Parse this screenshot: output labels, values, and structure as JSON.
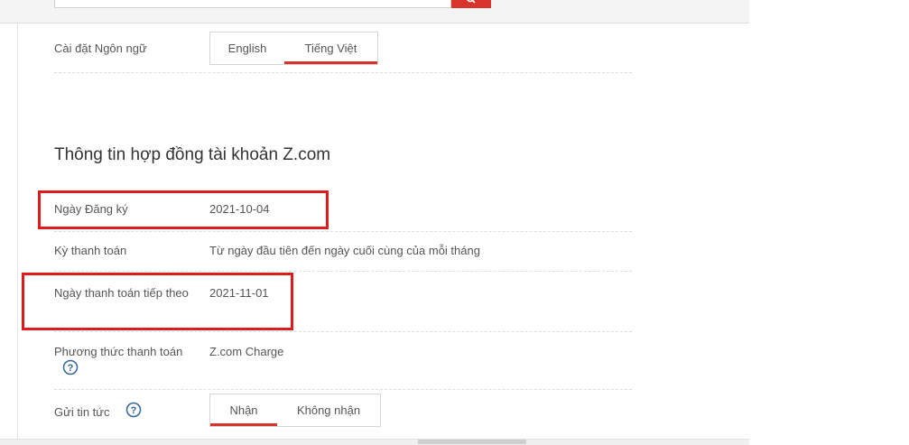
{
  "search": {
    "placeholder": ""
  },
  "language": {
    "label": "Cài đặt Ngôn ngữ",
    "options": [
      "English",
      "Tiếng Việt"
    ],
    "selected": "Tiếng Việt"
  },
  "contract": {
    "title": "Thông tin hợp đồng tài khoản Z.com",
    "rows": [
      {
        "label": "Ngày Đăng ký",
        "value": "2021-10-04"
      },
      {
        "label": "Kỳ thanh toán",
        "value": "Từ ngày đầu tiên đến ngày cuối cùng của mỗi tháng"
      },
      {
        "label": "Ngày thanh toán tiếp theo",
        "value": "2021-11-01"
      },
      {
        "label": "Phương thức thanh toán",
        "value": "Z.com Charge"
      }
    ]
  },
  "news": {
    "label": "Gửi tin tức",
    "options": [
      "Nhận",
      "Không nhận"
    ],
    "selected": "Nhận"
  },
  "colors": {
    "accent": "#d9342b",
    "highlight": "#e01b1b"
  }
}
